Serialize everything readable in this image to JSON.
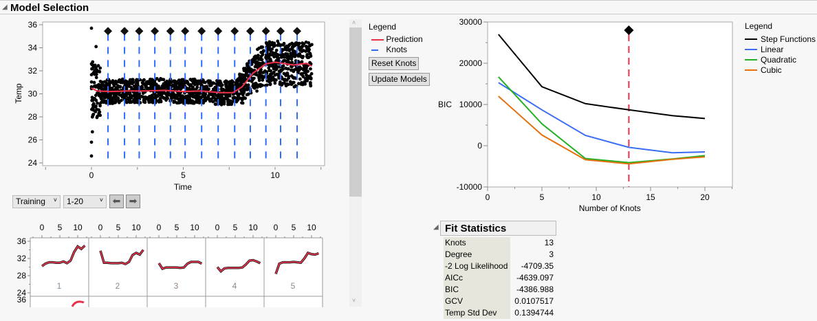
{
  "title": "Model Selection",
  "left_chart": {
    "ylabel": "Temp",
    "xlabel": "Time",
    "yticks": [
      24,
      26,
      28,
      30,
      32,
      34,
      36
    ],
    "xticks": [
      0,
      5,
      10
    ],
    "xlim": [
      -2.6,
      12.7
    ],
    "ylim": [
      23.8,
      36.2
    ],
    "knots": [
      0.9,
      1.8,
      2.6,
      3.45,
      4.3,
      5.1,
      6.0,
      6.9,
      7.8,
      8.65,
      9.5,
      10.3,
      11.2
    ],
    "prediction": [
      [
        0,
        30.5
      ],
      [
        0.3,
        30.25
      ],
      [
        1,
        30.2
      ],
      [
        2,
        30.25
      ],
      [
        3,
        30.25
      ],
      [
        4,
        30.3
      ],
      [
        5,
        30.2
      ],
      [
        6,
        30.25
      ],
      [
        7,
        30.1
      ],
      [
        7.7,
        30.1
      ],
      [
        8.2,
        30.6
      ],
      [
        8.8,
        31.8
      ],
      [
        9.5,
        32.6
      ],
      [
        10,
        32.75
      ],
      [
        11,
        32.5
      ],
      [
        11.7,
        32.65
      ],
      [
        12,
        32.4
      ]
    ],
    "colors": {
      "prediction": "#e8304a",
      "knots": "#2f6bff",
      "points": "#000000"
    }
  },
  "legend1": {
    "title": "Legend",
    "items": [
      "Prediction",
      "Knots"
    ]
  },
  "buttons": {
    "reset": "Reset Knots",
    "update": "Update Models"
  },
  "controls": {
    "set": "Training",
    "range": "1-20"
  },
  "chart_data": {
    "type": "line",
    "xlabel": "Number of Knots",
    "ylabel": "BIC",
    "xlim": [
      0,
      22.5
    ],
    "ylim": [
      -10000,
      30000
    ],
    "xticks": [
      0,
      5,
      10,
      15,
      20
    ],
    "yticks": [
      -10000,
      0,
      10000,
      20000,
      30000
    ],
    "yticklabels": [
      "-10000",
      "0",
      "10000",
      "20000",
      "30000"
    ],
    "x": [
      1,
      5,
      9,
      13,
      17,
      20
    ],
    "selected_knots": 13,
    "selected_marker_y": 28000,
    "series": [
      {
        "name": "Step Functions",
        "color": "#000000",
        "values": [
          27000,
          14300,
          10200,
          8700,
          7300,
          6600
        ]
      },
      {
        "name": "Linear",
        "color": "#3a6cf4",
        "values": [
          15300,
          8700,
          2500,
          -400,
          -1700,
          -1500
        ]
      },
      {
        "name": "Quadratic",
        "color": "#21b021",
        "values": [
          16700,
          5300,
          -3100,
          -4100,
          -3200,
          -2400
        ]
      },
      {
        "name": "Cubic",
        "color": "#e5700f",
        "values": [
          12000,
          2600,
          -3400,
          -4387,
          -3300,
          -2700
        ]
      }
    ],
    "legend_title": "Legend",
    "legend_position": "right"
  },
  "multiples": {
    "xticks": [
      "0",
      "5",
      "10"
    ],
    "yticks": [
      "36",
      "32",
      "28",
      "24"
    ],
    "row2_ytick": "36",
    "panels": [
      {
        "label": "1",
        "color": "#7a8fa8",
        "values": [
          30.2,
          30.8,
          31.1,
          31.1,
          31.0,
          31.0,
          31.3,
          30.9,
          31.5,
          33.5,
          34.8,
          34.2,
          35.0
        ]
      },
      {
        "label": "2",
        "color": "#8a8a8a",
        "values": [
          33.8,
          31.0,
          31.0,
          30.9,
          30.9,
          30.9,
          31.0,
          30.7,
          31.2,
          32.8,
          33.3,
          32.9,
          34.0
        ]
      },
      {
        "label": "3",
        "color": "#9a8070",
        "values": [
          30.9,
          29.6,
          29.9,
          29.9,
          29.9,
          29.9,
          29.8,
          29.9,
          30.8,
          31.2,
          31.2,
          31.2,
          30.8
        ]
      },
      {
        "label": "4",
        "color": "#80907a",
        "values": [
          30.0,
          29.0,
          29.7,
          29.8,
          29.8,
          29.8,
          29.8,
          29.9,
          30.6,
          31.5,
          31.6,
          31.3,
          30.9
        ]
      },
      {
        "label": "5",
        "color": "#8a8a8a",
        "values": [
          28.4,
          30.8,
          31.1,
          31.1,
          31.1,
          31.2,
          31.1,
          31.0,
          32.0,
          33.3,
          33.0,
          32.9,
          33.2
        ]
      }
    ]
  },
  "fit_statistics": {
    "title": "Fit Statistics",
    "rows": [
      {
        "label": "Knots",
        "value": "13"
      },
      {
        "label": "Degree",
        "value": "3"
      },
      {
        "label": "-2 Log Likelihood",
        "value": "-4709.35"
      },
      {
        "label": "AICc",
        "value": "-4639.097"
      },
      {
        "label": "BIC",
        "value": "-4386.988"
      },
      {
        "label": "GCV",
        "value": "0.0107517"
      },
      {
        "label": "Temp Std Dev",
        "value": "0.1394744"
      }
    ]
  }
}
